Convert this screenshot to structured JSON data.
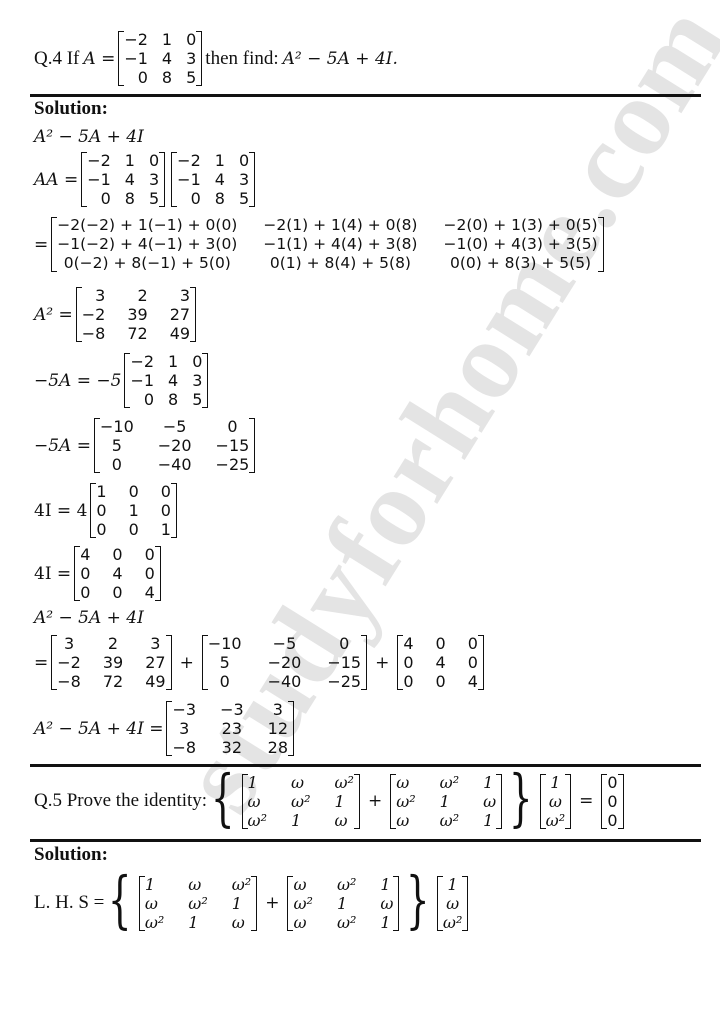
{
  "watermark": "studyforhome.com",
  "q4": {
    "label": "Q.4 If",
    "lhs": "A =",
    "matrix_A": [
      "−2",
      "1",
      "0",
      "−1",
      "4",
      "3",
      "0",
      "8",
      "5"
    ],
    "suffix": "then find:",
    "expr": "A² − 5A + 4I."
  },
  "sol1": {
    "heading": "Solution:",
    "line1": "A² − 5A + 4I",
    "aa_lhs": "AA =",
    "matrix_A": [
      "−2",
      "1",
      "0",
      "−1",
      "4",
      "3",
      "0",
      "8",
      "5"
    ],
    "eq": "=",
    "product_cells": [
      "−2(−2) + 1(−1) + 0(0)",
      "−2(1) + 1(4) + 0(8)",
      "−2(0) + 1(3) + 0(5)",
      "−1(−2) + 4(−1) + 3(0)",
      "−1(1) + 4(4) + 3(8)",
      "−1(0) + 4(3) + 3(5)",
      "0(−2) + 8(−1) + 5(0)",
      "0(1) + 8(4) + 5(8)",
      "0(0) + 8(3) + 5(5)"
    ],
    "a2_lhs": "A² =",
    "matrix_A2": [
      "3",
      "2",
      "3",
      "−2",
      "39",
      "27",
      "−8",
      "72",
      "49"
    ],
    "m5a_lhs": "−5A = −5",
    "m5a_lhs2": "−5A =",
    "matrix_m5A": [
      "−10",
      "−5",
      "0",
      "5",
      "−20",
      "−15",
      "0",
      "−40",
      "−25"
    ],
    "i4_lhs": "4I = 4",
    "matrix_I": [
      "1",
      "0",
      "0",
      "0",
      "1",
      "0",
      "0",
      "0",
      "1"
    ],
    "i4_lhs2": "4I =",
    "matrix_4I": [
      "4",
      "0",
      "0",
      "0",
      "4",
      "0",
      "0",
      "0",
      "4"
    ],
    "sum_label": "A² − 5A + 4I",
    "plus": "+",
    "final_lhs": "A² − 5A + 4I =",
    "matrix_result": [
      "−3",
      "−3",
      "3",
      "3",
      "23",
      "12",
      "−8",
      "32",
      "28"
    ]
  },
  "q5": {
    "label": "Q.5 Prove the identity:",
    "matrix_P": [
      "1",
      "ω",
      "ω²",
      "ω",
      "ω²",
      "1",
      "ω²",
      "1",
      "ω"
    ],
    "matrix_Q": [
      "ω",
      "ω²",
      "1",
      "ω²",
      "1",
      "ω",
      "ω",
      "ω²",
      "1"
    ],
    "vector_v": [
      "1",
      "ω",
      "ω²"
    ],
    "vector_zero": [
      "0",
      "0",
      "0"
    ],
    "plus": "+",
    "eq": "="
  },
  "sol2": {
    "heading": "Solution:",
    "lhs": "L. H. S =",
    "matrix_P": [
      "1",
      "ω",
      "ω²",
      "ω",
      "ω²",
      "1",
      "ω²",
      "1",
      "ω"
    ],
    "matrix_Q": [
      "ω",
      "ω²",
      "1",
      "ω²",
      "1",
      "ω",
      "ω",
      "ω²",
      "1"
    ],
    "vector_v": [
      "1",
      "ω",
      "ω²"
    ],
    "plus": "+"
  }
}
